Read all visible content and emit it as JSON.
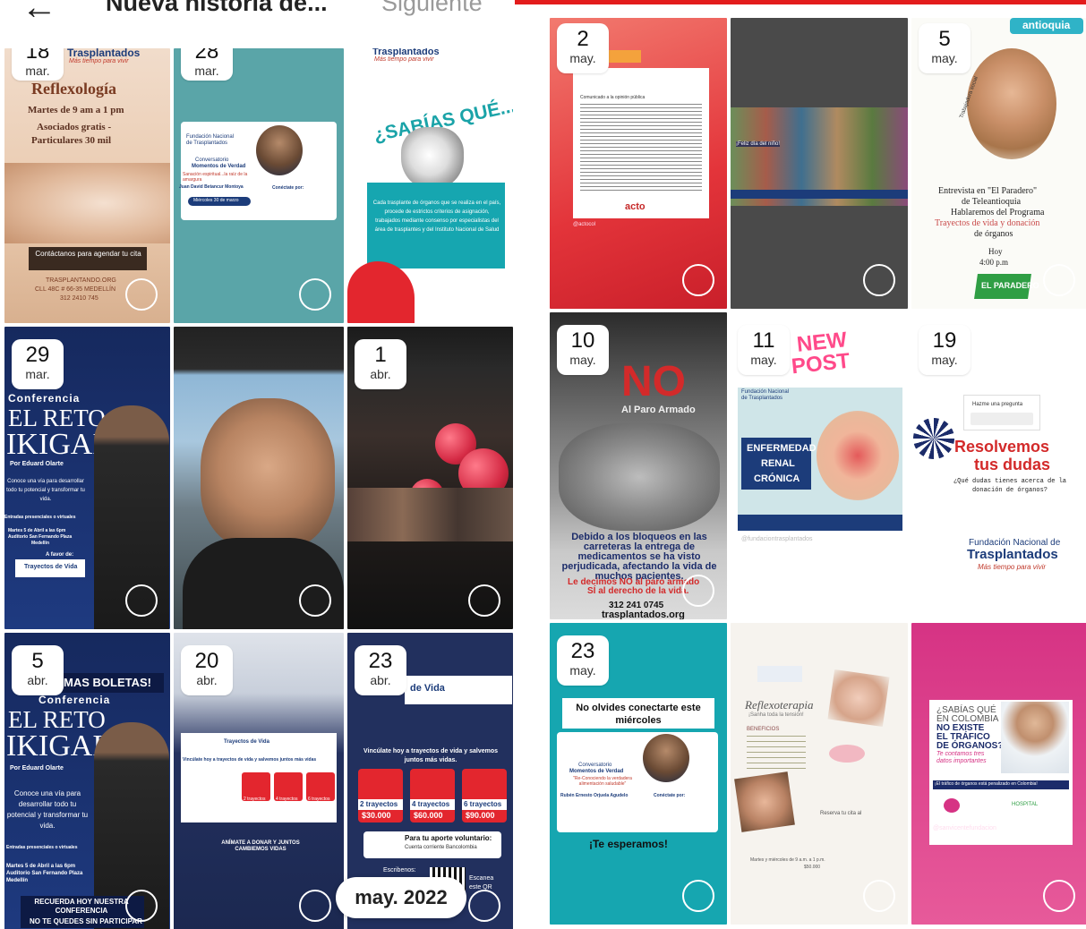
{
  "header": {
    "back_icon": "←",
    "title": "Nueva historia de...",
    "next_label": "Siguiente",
    "accent_color": "#e31c1c"
  },
  "month_pill": "may. 2022",
  "left_stories": [
    {
      "day": "18",
      "month": "mar.",
      "lines": [
        "Trasplantados",
        "Más tiempo para vivir",
        "Reflexología",
        "Martes de 9 am a 1 pm",
        "Asociados gratis -",
        "Particulares 30 mil",
        "Contáctanos para agendar tu cita",
        "TRASPLANTANDO.ORG",
        "CLL 48C # 66-35 MEDELLÍN",
        "312 2410 745"
      ]
    },
    {
      "day": "28",
      "month": "mar.",
      "lines": [
        "Fundación Nacional de Trasplantados",
        "Conversatorio",
        "Momentos de Verdad",
        "Sanación espiritual...la raíz de la amargura",
        "Juan David Betancur Montoya",
        "Miércoles 30 de marzo",
        "Conéctate por:"
      ]
    },
    {
      "day": "",
      "month": "",
      "lines": [
        "Trasplantados",
        "Más tiempo para vivir",
        "¿SABÍAS QUÉ...?",
        "Cada trasplante de órganos que se realiza en el país, procede de estrictos criterios de asignación, trabajados mediante consenso por especialistas del área de trasplantes y del Instituto Nacional de Salud"
      ]
    },
    {
      "day": "29",
      "month": "mar.",
      "lines": [
        "Conferencia",
        "EL RETO",
        "IKIGAI",
        "Por Eduard Olarte",
        "Conoce una vía para desarrollar todo tu potencial y transformar tu vida.",
        "Entradas presenciales o virtuales",
        "Martes 5 de Abril a las 6pm",
        "Auditorio San Fernando Plaza",
        "Medellín",
        "A favor de:",
        "Trayectos de Vida"
      ]
    },
    {
      "day": "",
      "month": "",
      "lines": []
    },
    {
      "day": "1",
      "month": "abr.",
      "lines": []
    },
    {
      "day": "5",
      "month": "abr.",
      "lines": [
        "MAS BOLETAS!",
        "Conferencia",
        "EL RETO",
        "IKIGAI",
        "Por Eduard Olarte",
        "Conoce una vía para desarrollar todo tu potencial y transformar tu vida.",
        "Entradas presenciales o virtuales",
        "Martes 5 de Abril a las 6pm",
        "Auditorio San Fernando Plaza",
        "Medellín",
        "RECUERDA HOY NUESTRA CONFERENCIA",
        "NO TE QUEDES SIN PARTICIPAR"
      ]
    },
    {
      "day": "20",
      "month": "abr.",
      "lines": [
        "Trayectos de Vida",
        "Vincúlate hoy a trayectos de vida y salvemos juntos más vidas",
        "2 trayectos",
        "4 trayectos",
        "6 trayectos",
        "ANÍMATE A DONAR Y JUNTOS CAMBIEMOS VIDAS"
      ]
    },
    {
      "day": "23",
      "month": "abr.",
      "lines": [
        "de Vida",
        "Vincúlate hoy a trayectos de vida y salvemos juntos más vidas.",
        "2 trayectos",
        "$30.000",
        "4 trayectos",
        "$60.000",
        "6 trayectos",
        "$90.000",
        "Para tu aporte voluntario:",
        "Cuenta corriente Bancolombia",
        "Escribenos:",
        "Escanea este QR"
      ]
    }
  ],
  "right_stories": [
    {
      "day": "2",
      "month": "may.",
      "lines": [
        "Comunicado a la opinión pública",
        "acto",
        "@actocol"
      ]
    },
    {
      "day": "",
      "month": "",
      "lines": [
        "¡Feliz día del niño!"
      ]
    },
    {
      "day": "5",
      "month": "may.",
      "lines": [
        "antioquia",
        "Trabajadora social",
        "Entrevista en \"El Paradero\"",
        "de Teleantioquia",
        "Hablaremos del Programa",
        "Trayectos de vida y donación",
        "de órganos",
        "Hoy",
        "4:00 p.m",
        "EL PARADERO"
      ]
    },
    {
      "day": "10",
      "month": "may.",
      "lines": [
        "NO",
        "Al Paro Armado",
        "Debido a los bloqueos en las carreteras la entrega de medicamentos se ha visto perjudicada, afectando la vida de muchos pacientes.",
        "Le decimos NO al paro armado",
        "SÍ al derecho de la vida.",
        "312 241 0745",
        "trasplantados.org"
      ]
    },
    {
      "day": "11",
      "month": "may.",
      "lines": [
        "NEW",
        "POST",
        "Fundación Nacional de Trasplantados",
        "ENFERMEDAD",
        "RENAL",
        "CRÓNICA",
        "@fundaciontrasplantados"
      ]
    },
    {
      "day": "19",
      "month": "may.",
      "lines": [
        "Hazme una pregunta",
        "Resolvemos",
        "tus dudas",
        "¿Qué dudas tienes acerca de la donación de órganos?",
        "Fundación Nacional de",
        "Trasplantados",
        "Más tiempo para vivir"
      ]
    },
    {
      "day": "23",
      "month": "may.",
      "lines": [
        "No olvides conectarte este miércoles",
        "Conversatorio",
        "Momentos de Verdad",
        "\"Re-Conociendo la verdadera alimentación saludable\"",
        "Rubén Ernesto Orjuela Agudelo",
        "Conéctate por:",
        "¡Te esperamos!"
      ]
    },
    {
      "day": "",
      "month": "",
      "lines": [
        "Reflexoterapia",
        "¡Sanha toda la tensión!",
        "BENEFICIOS",
        "Reserva tu cita al",
        "Martes y miércoles de 9 a.m. a 1 p.m.",
        "$50.000"
      ]
    },
    {
      "day": "",
      "month": "",
      "lines": [
        "¿SABÍAS QUÉ",
        "EN COLOMBIA",
        "NO EXISTE",
        "EL TRÁFICO",
        "DE ÓRGANOS?",
        "Te contamos tres datos importantes",
        "¡El tráfico de órganos está penalizado en Colombia!",
        "HOSPITAL",
        "@sanvicentefundacion"
      ]
    }
  ]
}
